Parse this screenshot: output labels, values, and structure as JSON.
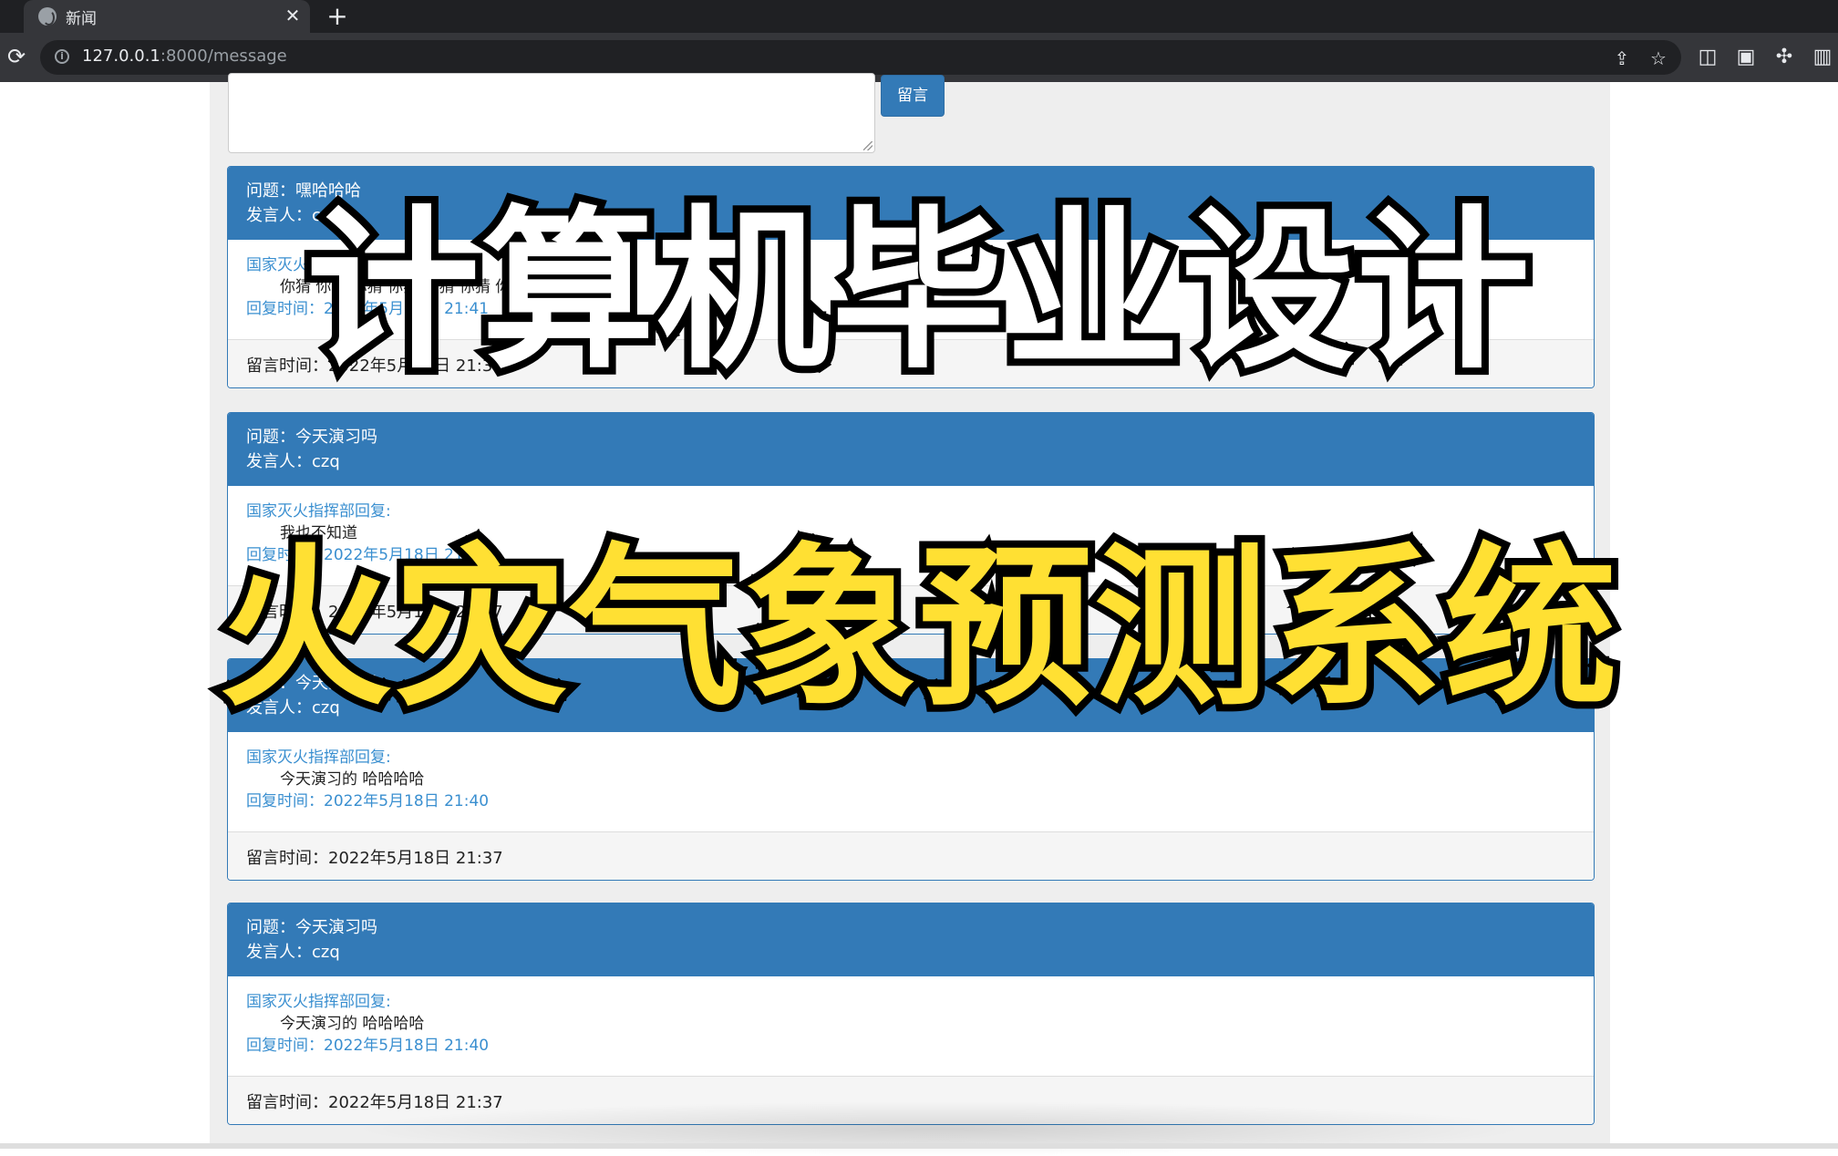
{
  "browser": {
    "tab": {
      "title": "新闻",
      "close": "✕"
    },
    "new_tab": "+",
    "url_host": "127.0.0.1",
    "url_rest": ":8000/message",
    "reload": "⟳"
  },
  "message_form": {
    "textarea_value": "",
    "submit_label": "留言"
  },
  "messages": [
    {
      "question": "问题：嘿哈哈哈",
      "author": "发言人：czq",
      "reply_label": "国家灭火指挥部回复:",
      "reply_content": "你猜 你猜 你猜 你猜 你猜 你猜 你猜",
      "reply_time": "回复时间：2022年5月18日 21:41",
      "message_time": "留言时间：2022年5月18日 21:37"
    },
    {
      "question": "问题：今天演习吗",
      "author": "发言人：czq",
      "reply_label": "国家灭火指挥部回复:",
      "reply_content": "我也不知道",
      "reply_time": "回复时间：2022年5月18日 21:41",
      "message_time": "留言时间：2022年5月18日 21:37"
    },
    {
      "question": "问题：今天演习吗",
      "author": "发言人：czq",
      "reply_label": "国家灭火指挥部回复:",
      "reply_content": "今天演习的 哈哈哈哈",
      "reply_time": "回复时间：2022年5月18日 21:40",
      "message_time": "留言时间：2022年5月18日 21:37"
    },
    {
      "question": "问题：今天演习吗",
      "author": "发言人：czq",
      "reply_label": "国家灭火指挥部回复:",
      "reply_content": "今天演习的 哈哈哈哈",
      "reply_time": "回复时间：2022年5月18日 21:40",
      "message_time": "留言时间：2022年5月18日 21:37"
    }
  ],
  "overlay": {
    "line1": "计算机毕业设计",
    "line2": "火灾气象预测系统"
  },
  "colors": {
    "panel_primary": "#337ab7",
    "reply_text": "#3a8fd0",
    "overlay_line2": "#ffe033"
  }
}
